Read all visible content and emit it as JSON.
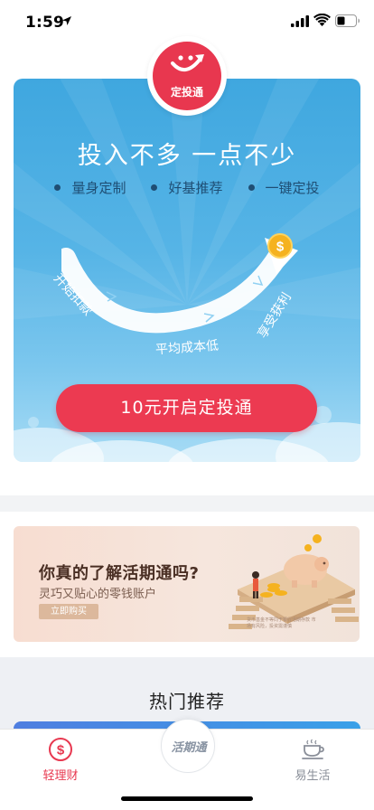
{
  "status_bar": {
    "time": "1:59"
  },
  "hero": {
    "logo_text": "定投通",
    "title": "投入不多 一点不少",
    "features": [
      "量身定制",
      "好基推荐",
      "一键定投"
    ],
    "curve_labels": {
      "start": "开始扣款",
      "average": "平均成本低",
      "profit": "享受获利"
    },
    "coin_symbol": "$",
    "cta_label": "10元开启定投通",
    "colors": {
      "background": "#3fa7df",
      "accent": "#ec3a51"
    }
  },
  "banner": {
    "title": "你真的了解活期通吗?",
    "subtitle": "灵巧又贴心的零钱账户",
    "button_label": "立即购买",
    "note": "货币基金不等同于银行活期存款 市场有风险，投资需谨慎"
  },
  "hot": {
    "title": "热门推荐"
  },
  "tab_bar": {
    "items": [
      {
        "label": "轻理财",
        "icon": "dollar-circle-icon",
        "active": true
      },
      {
        "label": "活期通",
        "icon": "center-badge",
        "active": false
      },
      {
        "label": "易生活",
        "icon": "coffee-cup-icon",
        "active": false
      }
    ],
    "active_color": "#e83850"
  }
}
